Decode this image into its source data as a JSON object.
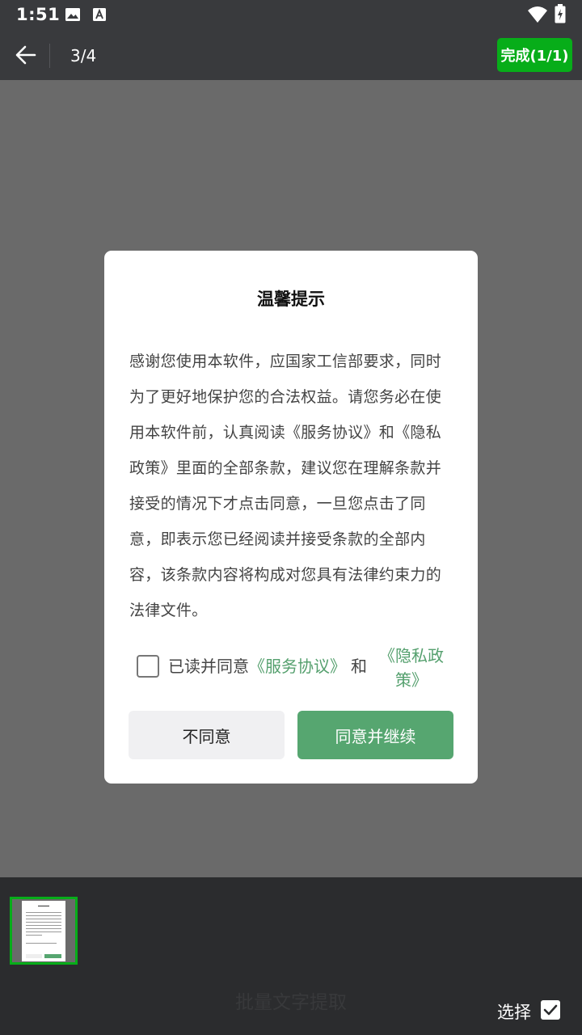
{
  "status_bar": {
    "time": "1:51",
    "icons": [
      "image-icon",
      "font-icon",
      "wifi-icon",
      "battery-icon"
    ]
  },
  "toolbar": {
    "back_icon": "arrow-left-icon",
    "page_counter": "3/4",
    "done_label": "完成(1/1)"
  },
  "dialog": {
    "title": "温馨提示",
    "body": "感谢您使用本软件，应国家工信部要求，同时为了更好地保护您的合法权益。请您务必在使用本软件前，认真阅读《服务协议》和《隐私政策》里面的全部条款，建议您在理解条款并接受的情况下才点击同意，一旦您点击了同意，即表示您已经阅读并接受条款的全部内容，该条款内容将构成对您具有法律约束力的法律文件。",
    "agree_prefix": "已读并同意",
    "service_link": "《服务协议》",
    "and_text": "和",
    "privacy_link": "《隐私政策》",
    "disagree_label": "不同意",
    "continue_label": "同意并继续"
  },
  "bottom": {
    "batch_extract_label": "批量文字提取",
    "select_label": "选择",
    "select_checked": true
  },
  "colors": {
    "accent_green": "#07ad19",
    "link_green": "#55a06e",
    "continue_button": "#56a670",
    "overlay": "#6a6a6a",
    "bar_background": "#393a3d"
  }
}
